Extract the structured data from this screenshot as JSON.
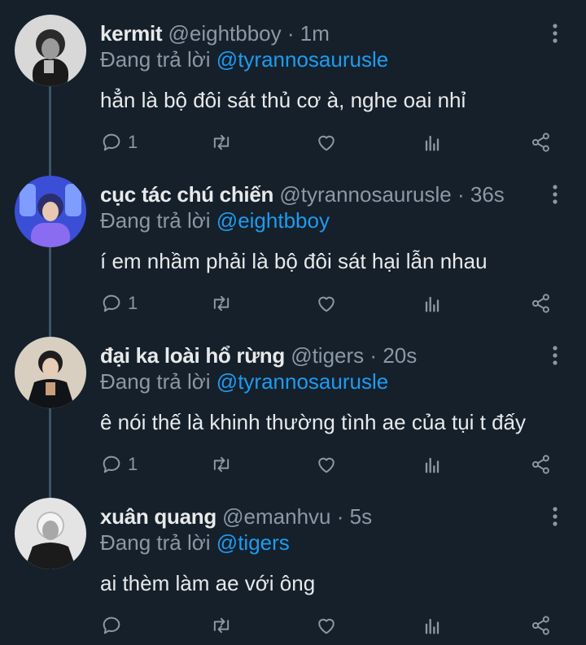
{
  "tweets": [
    {
      "name": "kermit",
      "handle": "@eightbboy",
      "sep": "·",
      "time": "1m",
      "reply_prefix": "Đang trả lời",
      "reply_to": "@tyrannosaurusle",
      "text": "hẳn là bộ đôi sát thủ cơ à, nghe oai nhỉ",
      "reply_count": "1"
    },
    {
      "name": "cục tác chú chiến",
      "handle": "@tyrannosaurusle",
      "sep": "·",
      "time": "36s",
      "reply_prefix": "Đang trả lời",
      "reply_to": "@eightbboy",
      "text": "í em nhầm phải là bộ đôi sát hại lẫn nhau",
      "reply_count": "1"
    },
    {
      "name": "đại ka loài hổ rừng",
      "handle": "@tigers",
      "sep": "·",
      "time": "20s",
      "reply_prefix": "Đang trả lời",
      "reply_to": "@tyrannosaurusle",
      "text": "ê nói thế là khinh thường tình ae của tụi t đấy",
      "reply_count": "1"
    },
    {
      "name": "xuân quang",
      "handle": "@emanhvu",
      "sep": "·",
      "time": "5s",
      "reply_prefix": "Đang trả lời",
      "reply_to": "@tigers",
      "text": "ai thèm làm ae với ông",
      "reply_count": ""
    }
  ],
  "colors": {
    "background": "#15202b",
    "text": "#e7e9ea",
    "muted": "#8b98a5",
    "mention": "#1d9bf0",
    "thread_line": "#3d5466"
  },
  "icons": [
    "more-vertical-icon",
    "reply-icon",
    "retweet-icon",
    "like-icon",
    "stats-icon",
    "share-icon"
  ]
}
